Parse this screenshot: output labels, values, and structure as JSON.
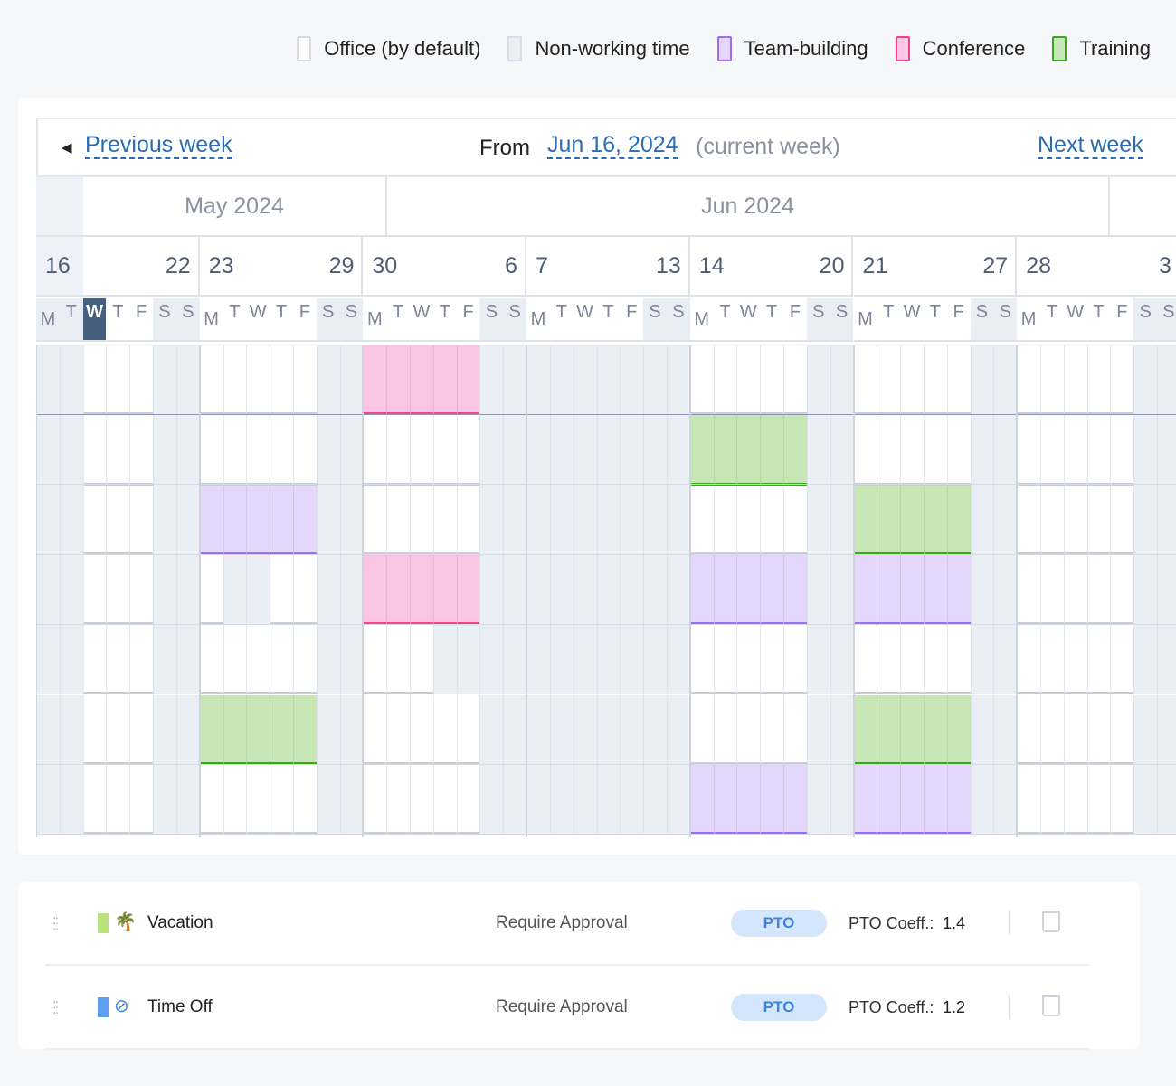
{
  "legend": [
    {
      "label": "Office (by default)",
      "code": "o",
      "fill": "#ffffff",
      "border": "#d8dbe1"
    },
    {
      "label": "Non-working time",
      "code": "n",
      "fill": "#eaeff6",
      "border": "#d8dde6"
    },
    {
      "label": "Team-building",
      "code": "t",
      "fill": "#e5d6fc",
      "border": "#9b6ef3"
    },
    {
      "label": "Conference",
      "code": "c",
      "fill": "#fcc4e4",
      "border": "#f0458f"
    },
    {
      "label": "Training",
      "code": "r",
      "fill": "#c7e6b6",
      "border": "#3aa81e"
    }
  ],
  "nav": {
    "prev": "Previous week",
    "from_label": "From",
    "date": "Jun 16, 2024",
    "current": "(current week)",
    "next": "Next week"
  },
  "months": [
    "May 2024",
    "Jun 2024"
  ],
  "weeks": [
    [
      "16",
      "22"
    ],
    [
      "23",
      "29"
    ],
    [
      "30",
      "6"
    ],
    [
      "7",
      "13"
    ],
    [
      "14",
      "20"
    ],
    [
      "21",
      "27"
    ],
    [
      "28",
      "3"
    ]
  ],
  "weekdays": [
    "M",
    "T",
    "W",
    "T",
    "F",
    "S",
    "S"
  ],
  "today": {
    "week": 0,
    "day": 2
  },
  "schedule": [
    [
      "nnooonn",
      "ooooonn",
      "cccccnn",
      "nnnnnnn",
      "ooooonn",
      "ooooonn",
      "ooooonn"
    ],
    [
      "nnooonn",
      "ooooonn",
      "ooooonn",
      "nnnnnnn",
      "rrrrrnn",
      "ooooonn",
      "ooooonn"
    ],
    [
      "nnooonn",
      "tttttnn",
      "ooooonn",
      "nnnnnnn",
      "ooooonn",
      "rrrrrnn",
      "ooooonn"
    ],
    [
      "nnooonn",
      "onnoonn",
      "cccccnn",
      "nnnnnnn",
      "tttttnn",
      "tttttnn",
      "ooooonn"
    ],
    [
      "nnooonn",
      "ooooonn",
      "ooonnnn",
      "nnnnnnn",
      "ooooonn",
      "ooooonn",
      "ooooonn"
    ],
    [
      "nnooonn",
      "rrrrrnn",
      "ooooonn",
      "nnnnnnn",
      "ooooonn",
      "rrrrrnn",
      "ooooonn"
    ],
    [
      "nnooonn",
      "ooooonn",
      "ooooonn",
      "nnnnnnn",
      "tttttnn",
      "tttttnn",
      "ooooonn"
    ]
  ],
  "types": [
    {
      "name": "Vacation",
      "color": "#b9e27a",
      "icon": "palm-tree-icon",
      "approval": "Require Approval",
      "badge": "PTO",
      "coeff_label": "PTO Coeff.:",
      "coeff": "1.4"
    },
    {
      "name": "Time Off",
      "color": "#5da0f0",
      "icon": "no-entry-icon",
      "approval": "Require Approval",
      "badge": "PTO",
      "coeff_label": "PTO Coeff.:",
      "coeff": "1.2"
    }
  ]
}
